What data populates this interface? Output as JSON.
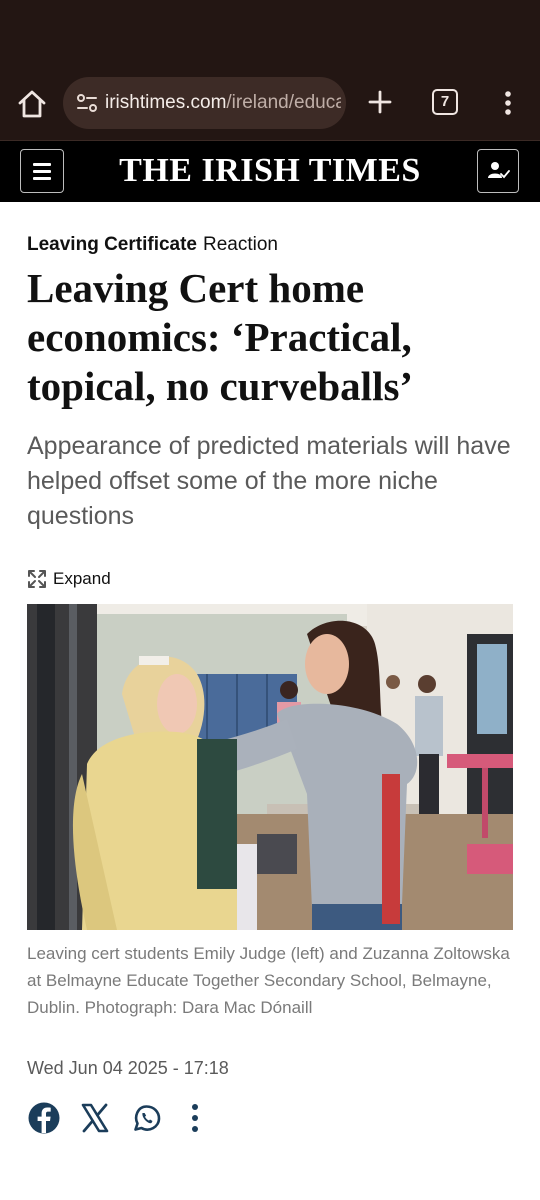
{
  "browser": {
    "url_domain": "irishtimes.com",
    "url_path": "/ireland/educa",
    "tab_count": "7"
  },
  "site": {
    "masthead": "THE IRISH TIMES"
  },
  "article": {
    "section": "Leaving Certificate",
    "type": "Reaction",
    "headline": "Leaving Cert home economics: ‘Practical, topical, no curveballs’",
    "standfirst": "Appearance of predicted materials will have helped offset some of the more niche questions",
    "expand_label": "Expand",
    "caption": "Leaving cert students Emily Judge (left) and Zuzanna Zoltowska at Belmayne Educate Together Secondary School, Belmayne, Dublin. Photograph: Dara Mac Dónaill",
    "date": "Wed Jun 04 2025 - 17:18"
  },
  "share": {
    "icons": [
      "facebook-icon",
      "x-icon",
      "whatsapp-icon",
      "more-vertical-icon"
    ]
  },
  "colors": {
    "browser_chrome": "#231613",
    "url_pill": "#3d2b26",
    "header_bg": "#000000",
    "share_icon": "#1b3d5a"
  }
}
